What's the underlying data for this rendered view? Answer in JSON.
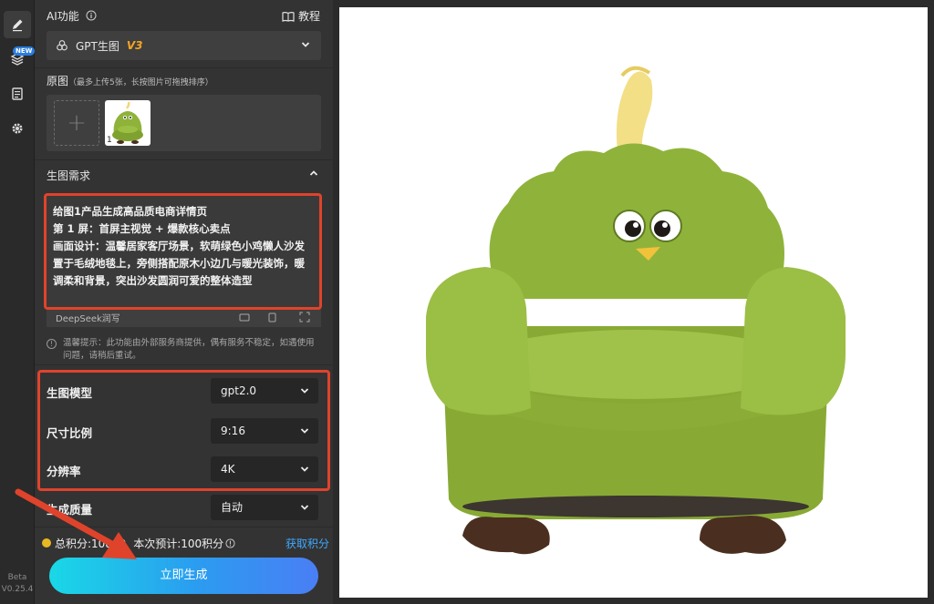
{
  "rail": {
    "badge": "NEW",
    "version_top": "Beta",
    "version_bottom": "V0.25.4"
  },
  "header": {
    "title": "AI功能",
    "tutorial": "教程"
  },
  "model": {
    "name": "GPT生图",
    "version": "V3"
  },
  "source": {
    "title": "原图",
    "hint": "（最多上传5张，长按图片可拖拽排序）",
    "thumb_number": "1"
  },
  "requirement": {
    "title": "生图需求",
    "text": "给图1产品生成高品质电商详情页\n第 1 屏：首屏主视觉 + 爆款核心卖点\n画面设计：温馨居家客厅场景，软萌绿色小鸡懒人沙发置于毛绒地毯上，旁侧搭配原木小边几与暖光装饰，暖调柔和背景，突出沙发圆润可爱的整体造型",
    "deepseek_label": "DeepSeek润写"
  },
  "tip": {
    "text": "温馨提示：此功能由外部服务商提供，偶有服务不稳定，如遇使用问题，请稍后重试。"
  },
  "settings": [
    {
      "label": "生图模型",
      "value": "gpt2.0"
    },
    {
      "label": "尺寸比例",
      "value": "9:16"
    },
    {
      "label": "分辨率",
      "value": "4K"
    },
    {
      "label": "生成质量",
      "value": "自动"
    }
  ],
  "points": {
    "total": "总积分:10800",
    "estimate": "本次预计:100积分",
    "get_points": "获取积分"
  },
  "generate_button": "立即生成",
  "colors": {
    "highlight": "#e0432b",
    "accent": "#3fa9ff",
    "sofa": "#8fb33a",
    "feet": "#4a2f20"
  }
}
